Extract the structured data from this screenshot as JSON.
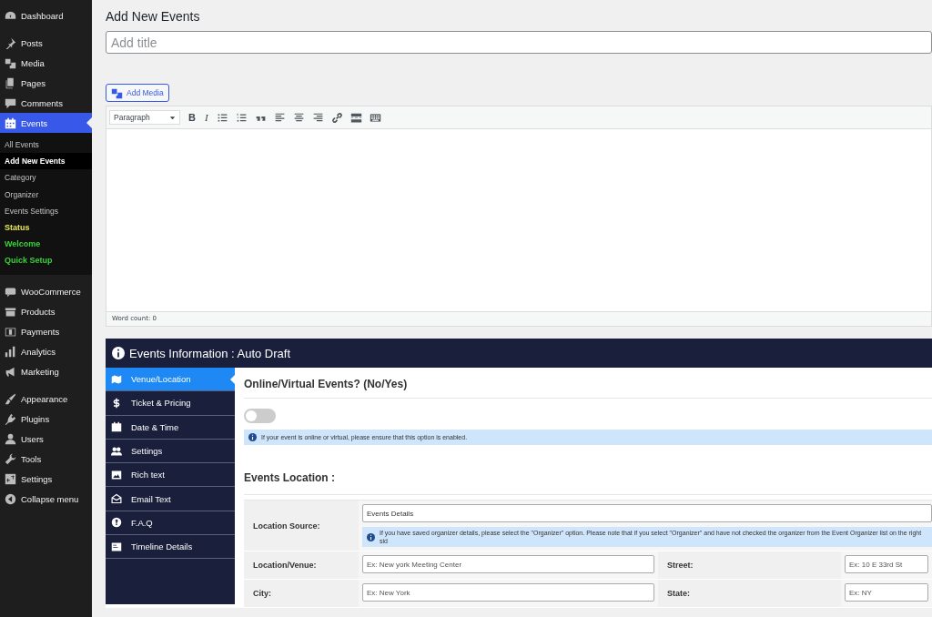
{
  "menu_groups": [
    [
      {
        "label": "Dashboard",
        "selected": false
      }
    ],
    [
      {
        "label": "Posts",
        "selected": false
      },
      {
        "label": "Media",
        "selected": false
      },
      {
        "label": "Pages",
        "selected": false
      },
      {
        "label": "Comments",
        "selected": false
      },
      {
        "label": "Events",
        "selected": true,
        "children": [
          {
            "label": "All Events",
            "selected": false
          },
          {
            "label": "Add New Events",
            "selected": true
          },
          {
            "label": "Category",
            "selected": false
          },
          {
            "label": "Organizer",
            "selected": false
          },
          {
            "label": "Events Settings",
            "selected": false
          },
          {
            "label": "Status",
            "selected": false,
            "color": "#e8e85a"
          },
          {
            "label": "Welcome",
            "selected": false,
            "color": "#3ad13a"
          },
          {
            "label": "Quick Setup",
            "selected": false,
            "color": "#3ad13a"
          }
        ]
      }
    ],
    [
      {
        "label": "WooCommerce",
        "selected": false
      },
      {
        "label": "Products",
        "selected": false
      },
      {
        "label": "Payments",
        "selected": false
      },
      {
        "label": "Analytics",
        "selected": false
      },
      {
        "label": "Marketing",
        "selected": false
      }
    ],
    [
      {
        "label": "Appearance",
        "selected": false
      },
      {
        "label": "Plugins",
        "selected": false
      },
      {
        "label": "Users",
        "selected": false
      },
      {
        "label": "Tools",
        "selected": false
      },
      {
        "label": "Settings",
        "selected": false
      },
      {
        "label": "Collapse menu",
        "selected": false
      }
    ]
  ],
  "page_title": "Add New Events",
  "title_field": {
    "placeholder": "Add title"
  },
  "add_media": "Add Media",
  "editor": {
    "format": "Paragraph",
    "text_buttons": [
      "B",
      "I"
    ],
    "word_count": "Word count: 0"
  },
  "events_panel": {
    "title": "Events Information : Auto Draft",
    "tabs": [
      {
        "label": "Venue/Location",
        "selected": true
      },
      {
        "label": "Ticket & Pricing",
        "selected": false
      },
      {
        "label": "Date & Time",
        "selected": false
      },
      {
        "label": "Settings",
        "selected": false
      },
      {
        "label": "Rich text",
        "selected": false
      },
      {
        "label": "Email Text",
        "selected": false
      },
      {
        "label": "F.A.Q",
        "selected": false
      },
      {
        "label": "Timeline Details",
        "selected": false
      }
    ],
    "online_heading": "Online/Virtual Events? (No/Yes)",
    "online_toggle": {
      "on": false
    },
    "online_note": "If your event is online or virtual, please ensure that this option is enabled.",
    "location_heading": "Events Location :",
    "location_source": {
      "label": "Location Source:",
      "value": "Events Details",
      "note": "If you have saved organizer details, please select the \"Organizer\" option. Please note that if you select \"Organizer\" and have not checked the organizer from the Event Organizer list on the right sid"
    },
    "rows": [
      [
        {
          "label": "Location/Venue:",
          "placeholder": "Ex: New york Meeting Center"
        },
        {
          "label": "Street:",
          "placeholder": "Ex: 10 E 33rd St"
        }
      ],
      [
        {
          "label": "City:",
          "placeholder": "Ex: New York"
        },
        {
          "label": "State:",
          "placeholder": "Ex: NY"
        }
      ]
    ]
  }
}
